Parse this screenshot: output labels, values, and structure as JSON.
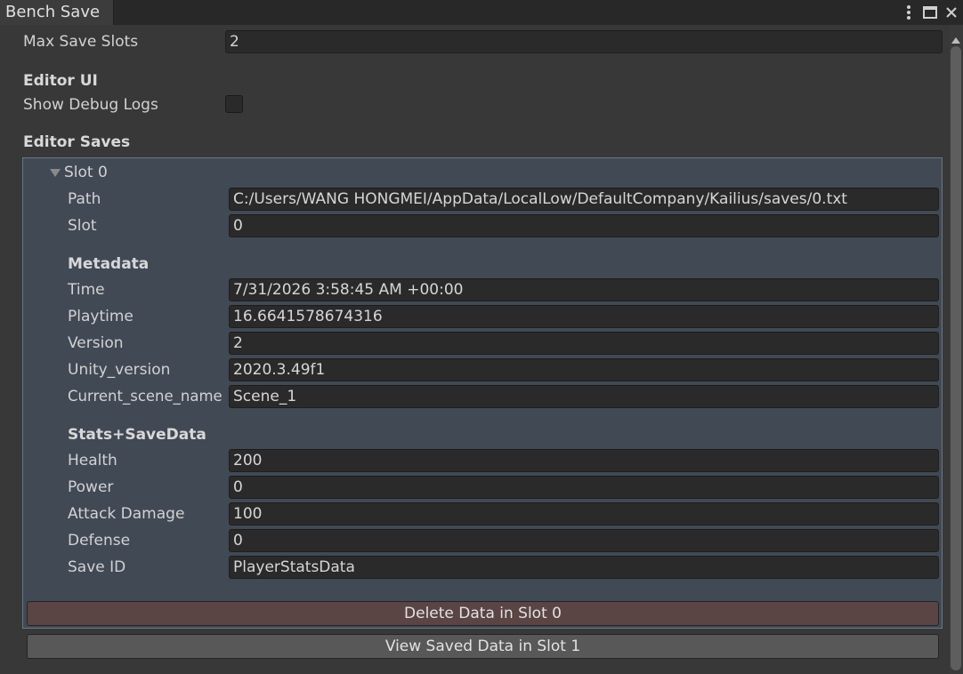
{
  "window": {
    "tab_title": "Bench Save",
    "icons": [
      "more-vert-icon",
      "maximize-icon",
      "close-icon"
    ]
  },
  "settings": {
    "max_save_slots_label": "Max Save Slots",
    "max_save_slots_value": "2",
    "editor_ui_header": "Editor UI",
    "show_debug_logs_label": "Show Debug Logs",
    "show_debug_logs_checked": false,
    "editor_saves_header": "Editor Saves"
  },
  "slot": {
    "foldout_label": "Slot 0",
    "path_label": "Path",
    "path_value": "C:/Users/WANG HONGMEI/AppData/LocalLow/DefaultCompany/Kailius/saves/0.txt",
    "slot_label": "Slot",
    "slot_value": "0",
    "metadata_header": "Metadata",
    "metadata": [
      {
        "label": "Time",
        "value": "7/31/2026 3:58:45 AM +00:00"
      },
      {
        "label": "Playtime",
        "value": "16.6641578674316"
      },
      {
        "label": "Version",
        "value": "2"
      },
      {
        "label": "Unity_version",
        "value": "2020.3.49f1"
      },
      {
        "label": "Current_scene_name",
        "value": "Scene_1"
      }
    ],
    "stats_header": "Stats+SaveData",
    "stats": [
      {
        "label": "Health",
        "value": "200"
      },
      {
        "label": "Power",
        "value": "0"
      },
      {
        "label": "Attack Damage",
        "value": "100"
      },
      {
        "label": "Defense",
        "value": "0"
      },
      {
        "label": "Save ID",
        "value": "PlayerStatsData"
      }
    ],
    "delete_button": "Delete Data in Slot 0"
  },
  "view_button": "View Saved Data in Slot 1",
  "colors": {
    "panel_bg": "#414955",
    "panel_border": "#6a7686",
    "delete_button_bg": "#5a4444"
  }
}
